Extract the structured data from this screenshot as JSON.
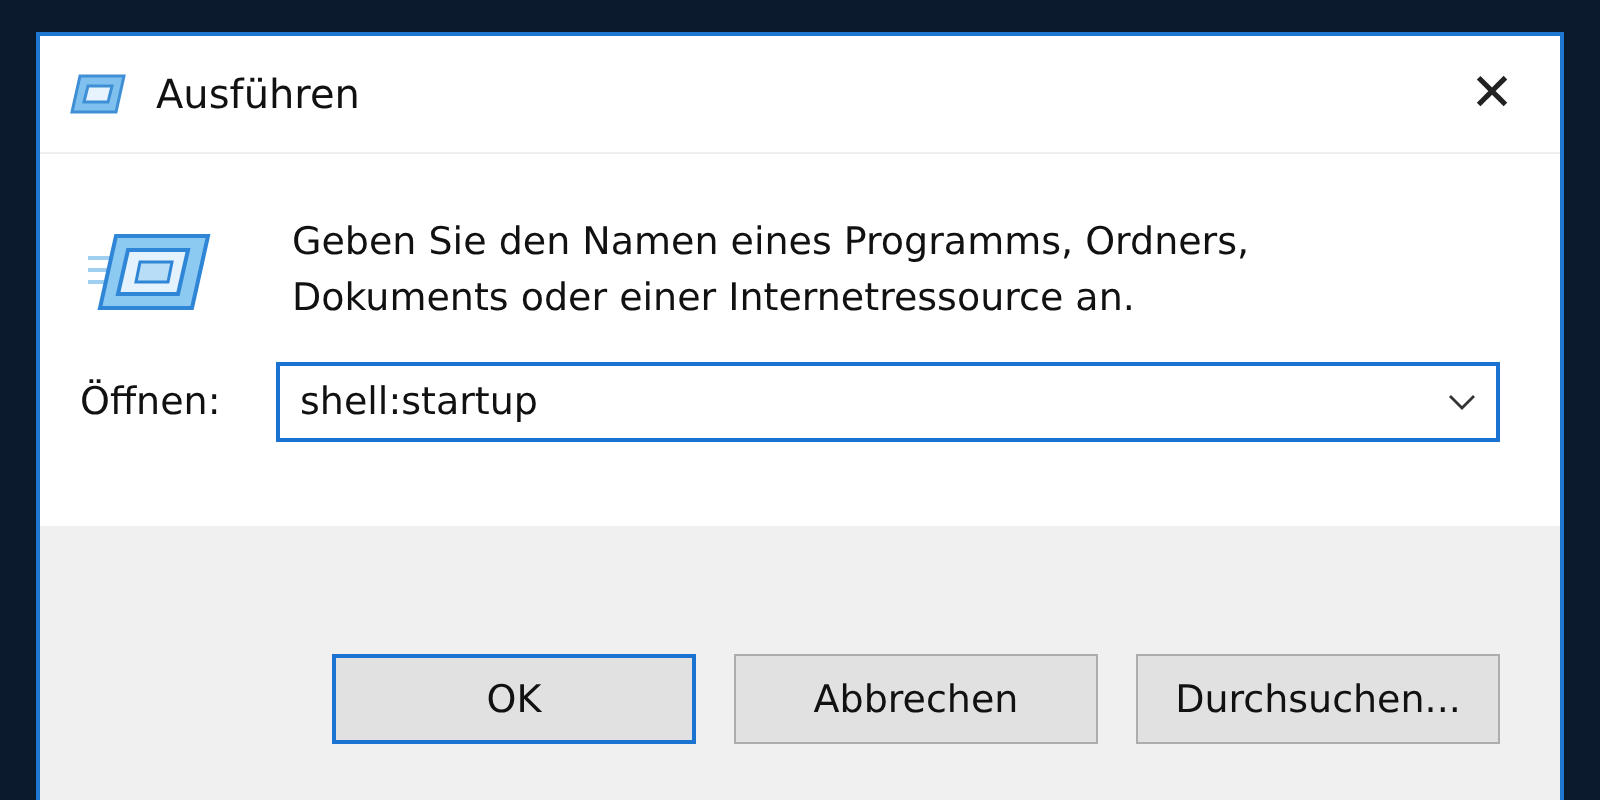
{
  "window": {
    "title": "Ausführen",
    "close_glyph": "✕"
  },
  "message": "Geben Sie den Namen eines Programms, Ordners, Dokuments oder einer Internetressource an.",
  "open_field": {
    "label": "Öffnen:",
    "value": "shell:startup",
    "focused": true
  },
  "buttons": [
    {
      "label": "OK",
      "default": true
    },
    {
      "label": "Abbrechen",
      "default": false
    },
    {
      "label": "Durchsuchen...",
      "default": false
    }
  ]
}
